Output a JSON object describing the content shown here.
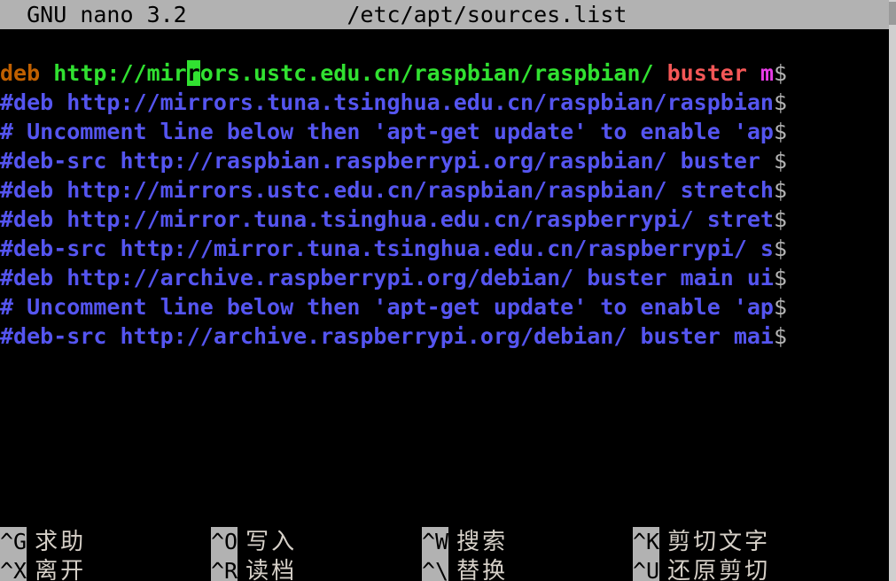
{
  "app": {
    "name": "GNU nano 3.2",
    "filename": "/etc/apt/sources.list",
    "title_left_pad": "  ",
    "title_gap": "            "
  },
  "colors": {
    "background": "#000000",
    "titlebar_bg": "#b2b2b2",
    "titlebar_fg": "#000000",
    "comment_blue": "#5555f0",
    "url_green": "#31e131",
    "keyword_orange": "#c06000",
    "suite_red": "#f45757",
    "component_magenta": "#e63ce6",
    "continuation_gray": "#b2b2b2",
    "cursor_green": "#31e131",
    "shortcut_label": "#d6d0c8"
  },
  "editor": {
    "continuation_marker": "$",
    "cursor": {
      "line": 1,
      "column": 13,
      "char": "r"
    },
    "lines": [
      {
        "id": "line-1",
        "segments": [
          {
            "text": "deb ",
            "color": "keyword_orange"
          },
          {
            "text": "http://mir",
            "color": "url_green"
          },
          {
            "text": "r",
            "color": "cursor"
          },
          {
            "text": "ors.ustc.edu.cn/raspbian/raspbian/ ",
            "color": "url_green"
          },
          {
            "text": "buster ",
            "color": "suite_red"
          },
          {
            "text": "m",
            "color": "component_magenta"
          }
        ],
        "continues": true
      },
      {
        "id": "line-2",
        "segments": [
          {
            "text": "#deb http://mirrors.tuna.tsinghua.edu.cn/raspbian/raspbian",
            "color": "comment_blue"
          }
        ],
        "continues": true
      },
      {
        "id": "line-3",
        "segments": [
          {
            "text": "# Uncomment line below then 'apt-get update' to enable 'ap",
            "color": "comment_blue"
          }
        ],
        "continues": true
      },
      {
        "id": "line-4",
        "segments": [
          {
            "text": "#deb-src http://raspbian.raspberrypi.org/raspbian/ buster ",
            "color": "comment_blue"
          }
        ],
        "continues": true
      },
      {
        "id": "line-5",
        "segments": [
          {
            "text": "#deb http://mirrors.ustc.edu.cn/raspbian/raspbian/ stretch",
            "color": "comment_blue"
          }
        ],
        "continues": true
      },
      {
        "id": "line-6",
        "segments": [
          {
            "text": "#deb http://mirror.tuna.tsinghua.edu.cn/raspberrypi/ stret",
            "color": "comment_blue"
          }
        ],
        "continues": true
      },
      {
        "id": "line-7",
        "segments": [
          {
            "text": "#deb-src http://mirror.tuna.tsinghua.edu.cn/raspberrypi/ s",
            "color": "comment_blue"
          }
        ],
        "continues": true
      },
      {
        "id": "line-8",
        "segments": [
          {
            "text": "#deb http://archive.raspberrypi.org/debian/ buster main ui",
            "color": "comment_blue"
          }
        ],
        "continues": true
      },
      {
        "id": "line-9",
        "segments": [
          {
            "text": "# Uncomment line below then 'apt-get update' to enable 'ap",
            "color": "comment_blue"
          }
        ],
        "continues": true
      },
      {
        "id": "line-10",
        "segments": [
          {
            "text": "#deb-src http://archive.raspberrypi.org/debian/ buster mai",
            "color": "comment_blue"
          }
        ],
        "continues": true
      }
    ]
  },
  "shortcuts": {
    "row1": [
      {
        "key": "^G",
        "label": "求助"
      },
      {
        "key": "^O",
        "label": "写入"
      },
      {
        "key": "^W",
        "label": "搜索"
      },
      {
        "key": "^K",
        "label": "剪切文字"
      }
    ],
    "row2": [
      {
        "key": "^X",
        "label": "离开"
      },
      {
        "key": "^R",
        "label": "读档"
      },
      {
        "key": "^\\",
        "label": "替换"
      },
      {
        "key": "^U",
        "label": "还原剪切"
      }
    ]
  }
}
